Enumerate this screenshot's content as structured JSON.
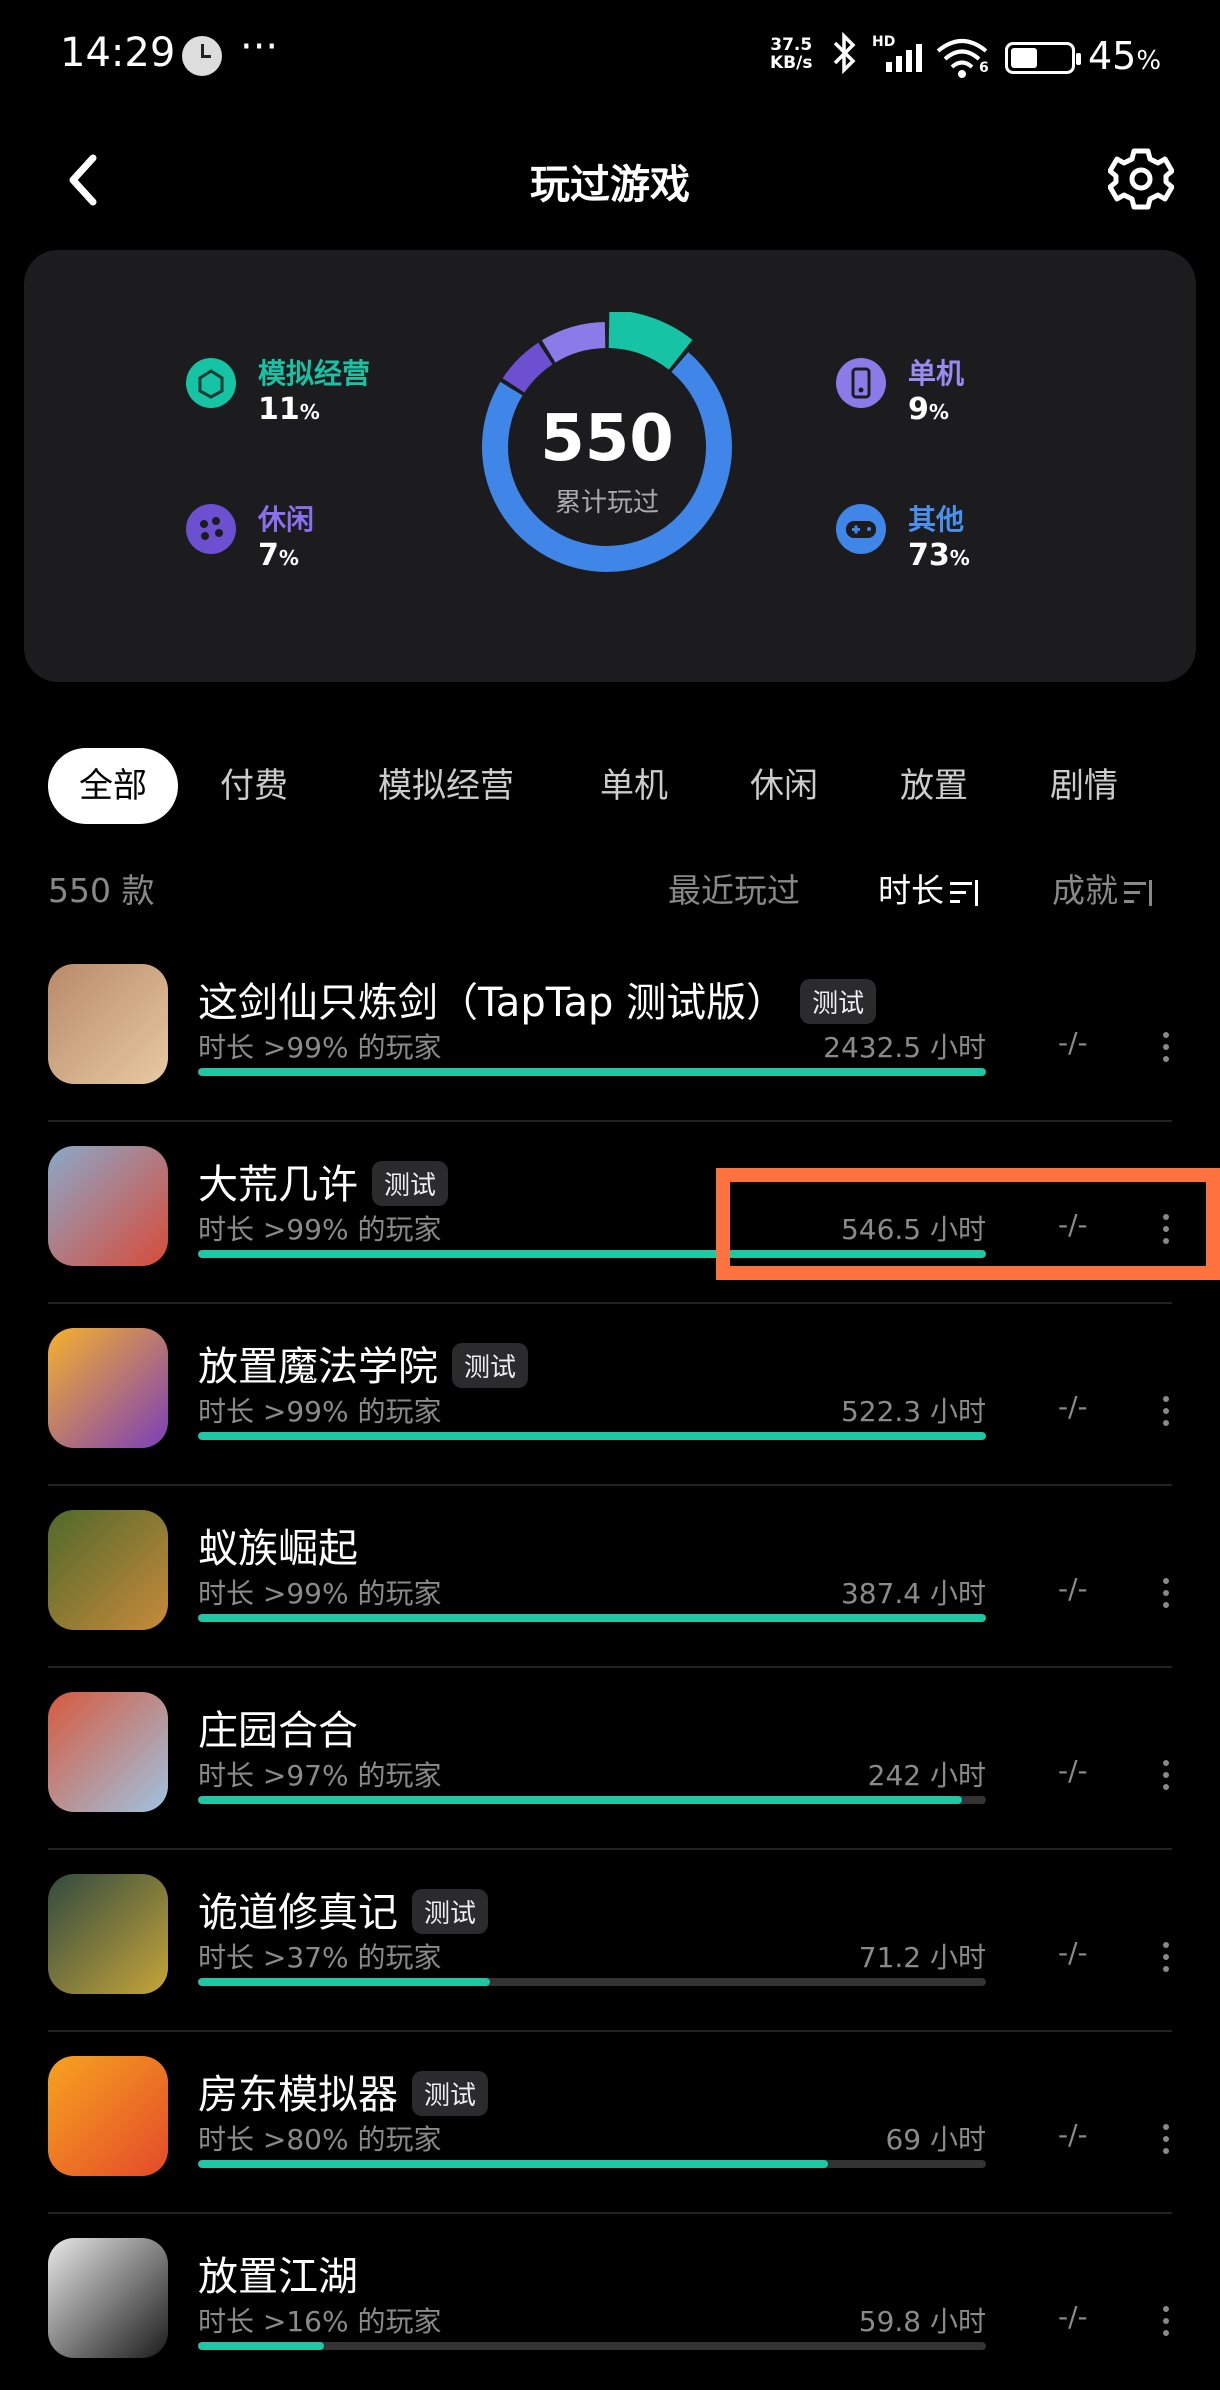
{
  "status_bar": {
    "time": "14:29",
    "dots": "···",
    "speed_value": "37.5",
    "speed_unit": "KB/s",
    "network_label": "HD",
    "wifi_label": "6",
    "battery": "45",
    "battery_unit": "%"
  },
  "header": {
    "title": "玩过游戏"
  },
  "summary": {
    "total": "550",
    "total_label": "累计玩过",
    "categories": [
      {
        "label": "模拟经营",
        "pct": "11",
        "unit": "%",
        "color": "#17c3a5",
        "share": 11
      },
      {
        "label": "休闲",
        "pct": "7",
        "unit": "%",
        "color": "#6d4fd1",
        "share": 7
      },
      {
        "label": "单机",
        "pct": "9",
        "unit": "%",
        "color": "#8a7be8",
        "share": 9
      },
      {
        "label": "其他",
        "pct": "73",
        "unit": "%",
        "color": "#3f86e8",
        "share": 73
      }
    ]
  },
  "tabs": [
    "全部",
    "付费",
    "模拟经营",
    "单机",
    "休闲",
    "放置",
    "剧情"
  ],
  "list_header": {
    "count": "550 款",
    "sort_recent": "最近玩过",
    "sort_duration": "时长",
    "sort_achievement": "成就"
  },
  "games": [
    {
      "name": "这剑仙只炼剑（TapTap 测试版）",
      "badge": "测试",
      "sub": "时长 >99% 的玩家",
      "hours": "2432.5 小时",
      "ach": "-/-",
      "fill": 1.0,
      "colors": [
        "#b88a6a",
        "#e8c9a4"
      ]
    },
    {
      "name": "大荒几许",
      "badge": "测试",
      "sub": "时长 >99% 的玩家",
      "hours": "546.5 小时",
      "ach": "-/-",
      "fill": 1.0,
      "colors": [
        "#8aa9c9",
        "#d84b3a"
      ]
    },
    {
      "name": "放置魔法学院",
      "badge": "测试",
      "sub": "时长 >99% 的玩家",
      "hours": "522.3 小时",
      "ach": "-/-",
      "fill": 1.0,
      "colors": [
        "#f6b12b",
        "#7b3fb8"
      ]
    },
    {
      "name": "蚁族崛起",
      "badge": "",
      "sub": "时长 >99% 的玩家",
      "hours": "387.4 小时",
      "ach": "-/-",
      "fill": 1.0,
      "colors": [
        "#4f6a2a",
        "#c78a3b"
      ]
    },
    {
      "name": "庄园合合",
      "badge": "",
      "sub": "时长 >97% 的玩家",
      "hours": "242 小时",
      "ach": "-/-",
      "fill": 0.97,
      "colors": [
        "#d7593d",
        "#9fc3e0"
      ]
    },
    {
      "name": "诡道修真记",
      "badge": "测试",
      "sub": "时长 >37% 的玩家",
      "hours": "71.2 小时",
      "ach": "-/-",
      "fill": 0.37,
      "colors": [
        "#2f4a3f",
        "#c7a53a"
      ]
    },
    {
      "name": "房东模拟器",
      "badge": "测试",
      "sub": "时长 >80% 的玩家",
      "hours": "69 小时",
      "ach": "-/-",
      "fill": 0.8,
      "colors": [
        "#f7a31e",
        "#e34a2a"
      ]
    },
    {
      "name": "放置江湖",
      "badge": "",
      "sub": "时长 >16% 的玩家",
      "hours": "59.8 小时",
      "ach": "-/-",
      "fill": 0.16,
      "colors": [
        "#e9e9e9",
        "#1b1b1b"
      ]
    }
  ],
  "colors": {
    "accent": "#1fc7a4",
    "highlight": "#ff7240",
    "card": "#1c1c1e"
  }
}
